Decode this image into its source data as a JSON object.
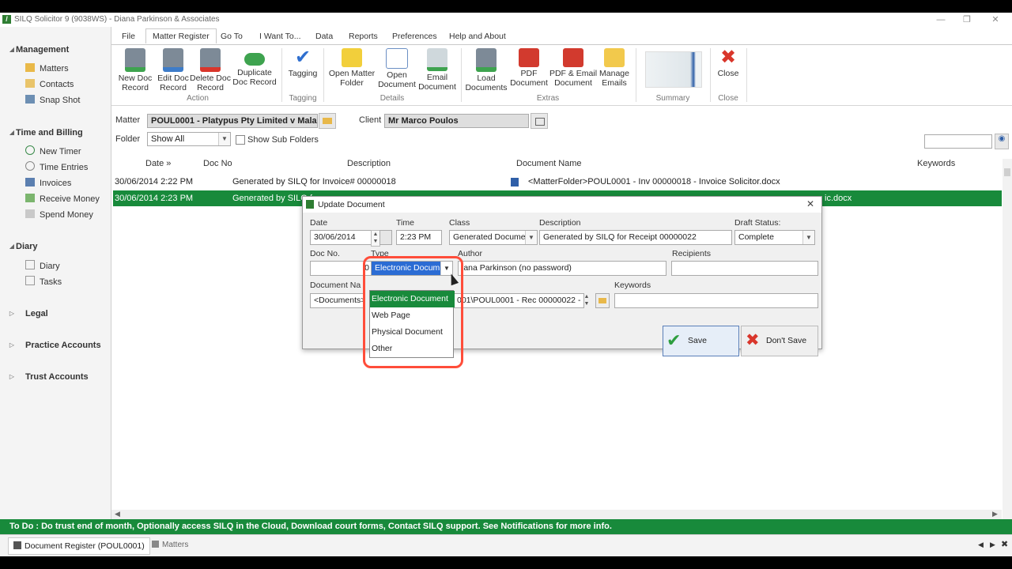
{
  "window": {
    "title": "SILQ Solicitor 9 (9038WS) - Diana Parkinson & Associates",
    "logo_glyph": "/"
  },
  "sidebar": {
    "sections": [
      {
        "label": "Management",
        "items": [
          "Matters",
          "Contacts",
          "Snap Shot"
        ]
      },
      {
        "label": "Time and Billing",
        "items": [
          "New Timer",
          "Time Entries",
          "Invoices",
          "Receive Money",
          "Spend Money"
        ]
      },
      {
        "label": "Diary",
        "items": [
          "Diary",
          "Tasks"
        ]
      },
      {
        "label": "Legal"
      },
      {
        "label": "Practice Accounts"
      },
      {
        "label": "Trust Accounts"
      }
    ]
  },
  "ribbon": {
    "tabs": [
      "File",
      "Matter Register",
      "Go To",
      "I Want To...",
      "Data",
      "Reports",
      "Preferences",
      "Help and About"
    ],
    "buttons": {
      "new_doc": "New Doc\nRecord",
      "edit_doc": "Edit Doc\nRecord",
      "delete_doc": "Delete Doc\nRecord",
      "duplicate_doc": "Duplicate\nDoc Record",
      "tagging": "Tagging",
      "open_folder": "Open Matter\nFolder",
      "open_doc": "Open\nDocument",
      "email_doc": "Email\nDocument",
      "load_docs": "Load\nDocuments",
      "pdf_doc": "PDF\nDocument",
      "pdf_email": "PDF & Email\nDocument",
      "manage_emails": "Manage\nEmails",
      "close": "Close"
    },
    "groups": [
      "Action",
      "Tagging",
      "Details",
      "Extras",
      "Summary",
      "Close"
    ]
  },
  "matter_bar": {
    "matter_label": "Matter",
    "matter_value": "POUL0001 - Platypus Pty Limited v Malach",
    "client_label": "Client",
    "client_value": "Mr Marco Poulos",
    "folder_label": "Folder",
    "folder_value": "Show All",
    "subfolders_label": "Show Sub Folders"
  },
  "grid": {
    "columns": [
      "Date »",
      "Doc No",
      "Description",
      "Document Name",
      "Keywords"
    ],
    "rows": [
      {
        "date": "30/06/2014 2:22 PM",
        "desc": "Generated by SILQ for Invoice# 00000018",
        "docname": "<MatterFolder>POUL0001 - Inv 00000018 - Invoice Solicitor.docx"
      },
      {
        "date": "30/06/2014 2:23 PM",
        "desc": "Generated by SILQ f",
        "docname": "ic.docx"
      }
    ]
  },
  "dialog": {
    "title": "Update Document",
    "close_glyph": "✕",
    "date_label": "Date",
    "date_value": "30/06/2014",
    "time_label": "Time",
    "time_value": "2:23 PM",
    "class_label": "Class",
    "class_value": "Generated Docume",
    "description_label": "Description",
    "description_value": "Generated by SILQ for Receipt 00000022",
    "draft_label": "Draft Status:",
    "draft_value": "Complete",
    "docno_label": "Doc No.",
    "docno_value": "0",
    "type_label": "Type",
    "type_value": "Electronic Docum",
    "author_label": "Author",
    "author_value": "iana Parkinson (no password)",
    "recipients_label": "Recipients",
    "docname_label": "Document Na",
    "docname_value": "<Documents>",
    "path_value": "001\\POUL0001 - Rec 00000022 -",
    "keywords_label": "Keywords",
    "save_label": "Save",
    "dontsave_label": "Don't Save",
    "type_options": [
      "Electronic Document",
      "Web Page",
      "Physical Document",
      "Other"
    ]
  },
  "status": {
    "todo": "To Do : Do trust end of month, Optionally access SILQ in the Cloud, Download court forms, Contact SILQ support. See Notifications for more info."
  },
  "taskbar": {
    "items": [
      "Document Register (POUL0001)",
      "Matters"
    ]
  },
  "colors": {
    "accent_green": "#188a3b",
    "highlight_red": "#ff4d3a"
  }
}
